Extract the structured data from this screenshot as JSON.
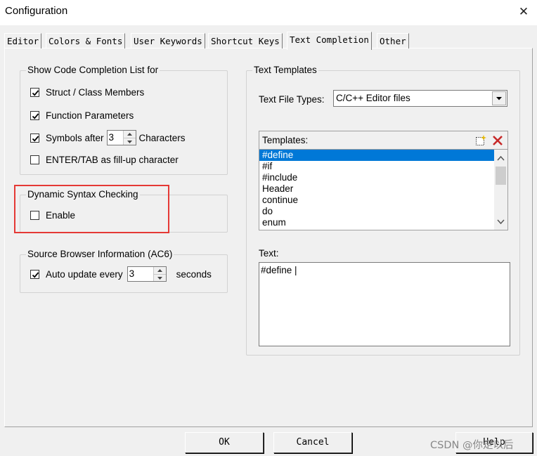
{
  "window": {
    "title": "Configuration",
    "close_glyph": "✕"
  },
  "tabs": [
    "Editor",
    "Colors & Fonts",
    "User Keywords",
    "Shortcut Keys",
    "Text Completion",
    "Other"
  ],
  "active_tab": "Text Completion",
  "code_completion": {
    "legend": "Show Code Completion List for",
    "struct_members": {
      "label": "Struct / Class Members",
      "checked": true
    },
    "function_params": {
      "label": "Function Parameters",
      "checked": true
    },
    "symbols_after": {
      "label": "Symbols after",
      "checked": true,
      "value": "3",
      "suffix": "Characters"
    },
    "enter_tab": {
      "label": "ENTER/TAB as fill-up character",
      "checked": false
    }
  },
  "dynamic_syntax": {
    "legend": "Dynamic Syntax Checking",
    "enable": {
      "label": "Enable",
      "checked": false
    },
    "highlight_color": "#e53935"
  },
  "source_browser": {
    "legend": "Source Browser Information (AC6)",
    "auto_update": {
      "label": "Auto update every",
      "checked": true,
      "value": "3",
      "suffix": "seconds"
    }
  },
  "text_templates": {
    "legend": "Text Templates",
    "file_types_label": "Text File Types:",
    "file_types_value": "C/C++ Editor files",
    "templates_label": "Templates:",
    "templates": [
      "#define",
      "#if",
      "#include",
      "Header",
      "continue",
      "do",
      "enum"
    ],
    "selected_template": "#define",
    "text_label": "Text:",
    "text_value": "#define |",
    "new_icon": "new-item-icon",
    "delete_icon": "delete-x-icon",
    "selection_color": "#0078d7"
  },
  "buttons": {
    "ok": "OK",
    "cancel": "Cancel",
    "help": "Help"
  },
  "watermark": "CSDN @你走以后"
}
